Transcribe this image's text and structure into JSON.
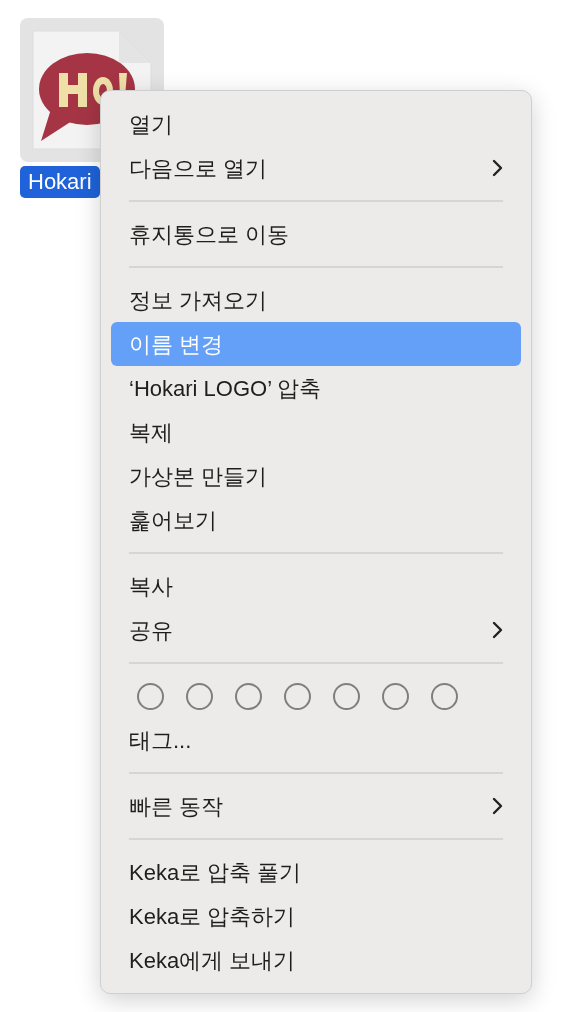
{
  "file": {
    "name": "Hokari",
    "selected": true
  },
  "context_menu": {
    "items": [
      {
        "kind": "item",
        "label": "열기",
        "selected": false,
        "submenu": false
      },
      {
        "kind": "item",
        "label": "다음으로 열기",
        "selected": false,
        "submenu": true
      },
      {
        "kind": "separator"
      },
      {
        "kind": "item",
        "label": "휴지통으로 이동",
        "selected": false,
        "submenu": false
      },
      {
        "kind": "separator"
      },
      {
        "kind": "item",
        "label": "정보 가져오기",
        "selected": false,
        "submenu": false
      },
      {
        "kind": "item",
        "label": "이름 변경",
        "selected": true,
        "submenu": false
      },
      {
        "kind": "item",
        "label": "‘Hokari LOGO’ 압축",
        "selected": false,
        "submenu": false
      },
      {
        "kind": "item",
        "label": "복제",
        "selected": false,
        "submenu": false
      },
      {
        "kind": "item",
        "label": "가상본 만들기",
        "selected": false,
        "submenu": false
      },
      {
        "kind": "item",
        "label": "훑어보기",
        "selected": false,
        "submenu": false
      },
      {
        "kind": "separator"
      },
      {
        "kind": "item",
        "label": "복사",
        "selected": false,
        "submenu": false
      },
      {
        "kind": "item",
        "label": "공유",
        "selected": false,
        "submenu": true
      },
      {
        "kind": "separator"
      },
      {
        "kind": "tags"
      },
      {
        "kind": "item",
        "label": "태그...",
        "selected": false,
        "submenu": false
      },
      {
        "kind": "separator"
      },
      {
        "kind": "item",
        "label": "빠른 동작",
        "selected": false,
        "submenu": true
      },
      {
        "kind": "separator"
      },
      {
        "kind": "item",
        "label": "Keka로 압축 풀기",
        "selected": false,
        "submenu": false
      },
      {
        "kind": "item",
        "label": "Keka로 압축하기",
        "selected": false,
        "submenu": false
      },
      {
        "kind": "item",
        "label": "Keka에게 보내기",
        "selected": false,
        "submenu": false
      }
    ]
  }
}
